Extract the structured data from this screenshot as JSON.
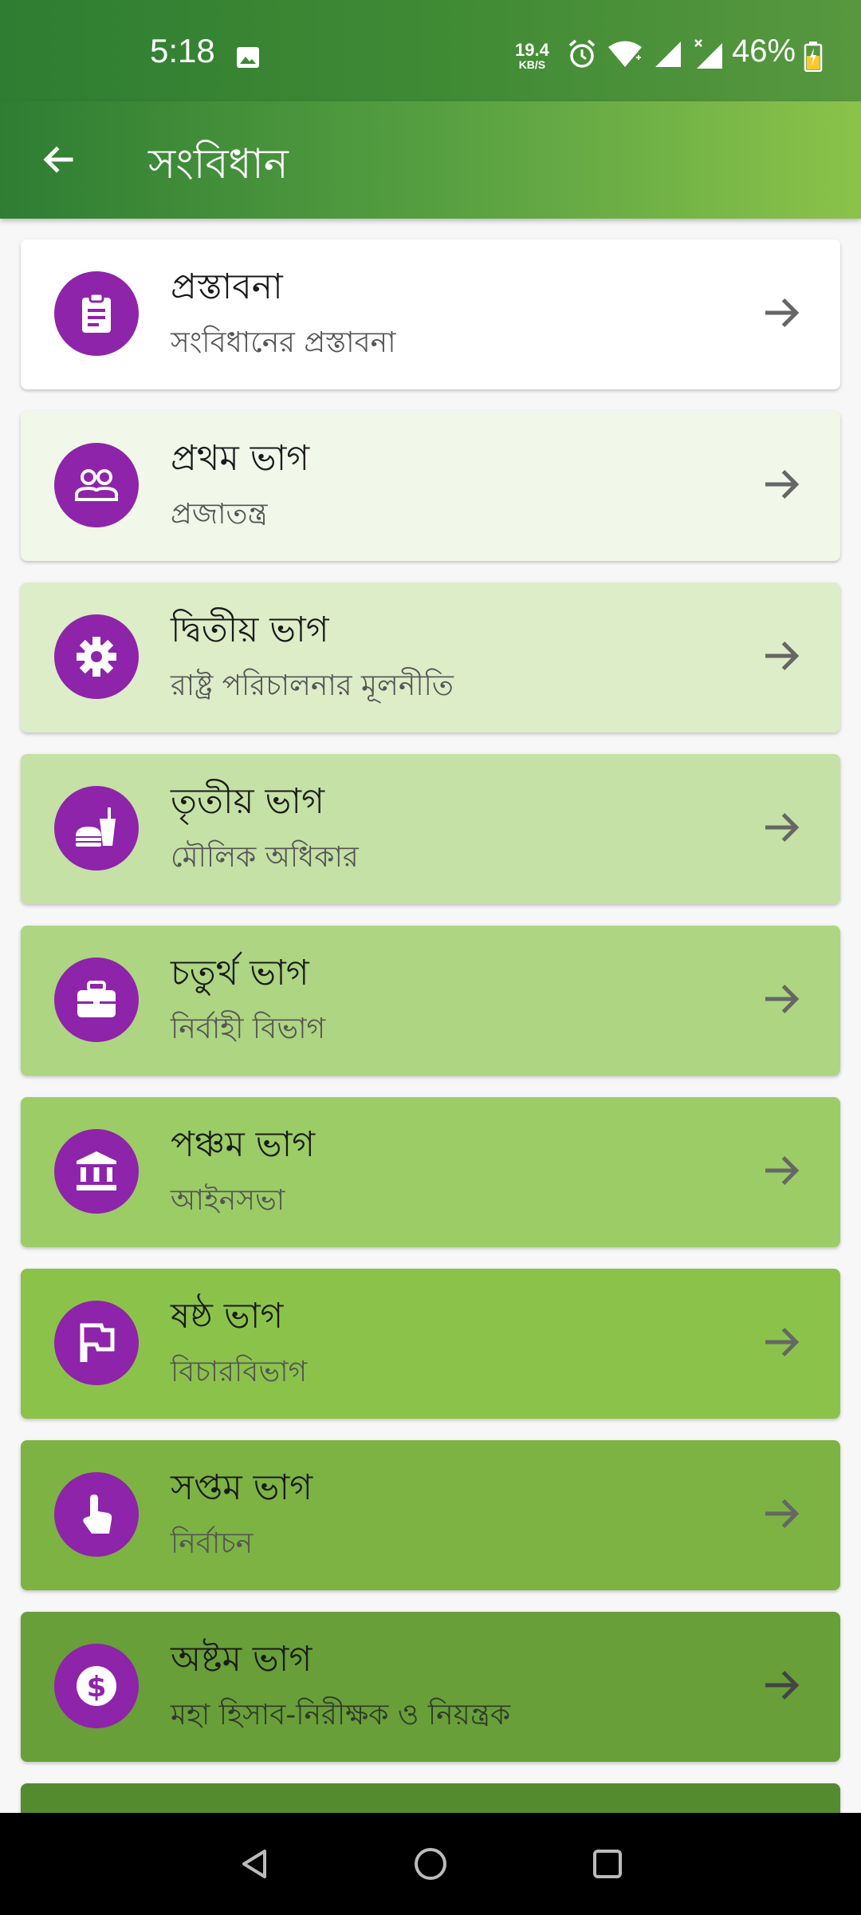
{
  "status_bar": {
    "time": "5:18",
    "net_speed_value": "19.4",
    "net_speed_unit": "KB/S",
    "battery": "46%",
    "icons": [
      "image-icon",
      "alarm-icon",
      "wifi-icon",
      "signal-icon",
      "signal-no-data-icon",
      "battery-charging-icon"
    ]
  },
  "app_bar": {
    "title": "সংবিধান",
    "back_icon": "arrow-back-icon"
  },
  "colors": {
    "icon_circle": "#8e24aa",
    "card_backgrounds": [
      "#ffffff",
      "#f1f8e9",
      "#dcedc8",
      "#c5e1a5",
      "#aed581",
      "#9ccc65",
      "#8bc34a",
      "#7cb342",
      "#689f38",
      "#558b2f"
    ]
  },
  "items": [
    {
      "title": "প্রস্তাবনা",
      "subtitle": "সংবিধানের প্রস্তাবনা",
      "icon": "clipboard-icon"
    },
    {
      "title": "প্রথম ভাগ",
      "subtitle": "প্রজাতন্ত্র",
      "icon": "people-icon"
    },
    {
      "title": "দ্বিতীয় ভাগ",
      "subtitle": "রাষ্ট্র পরিচালনার মূলনীতি",
      "icon": "gear-icon"
    },
    {
      "title": "তৃতীয় ভাগ",
      "subtitle": "মৌলিক অধিকার",
      "icon": "fastfood-icon"
    },
    {
      "title": "চতুর্থ ভাগ",
      "subtitle": "নির্বাহী বিভাগ",
      "icon": "briefcase-icon"
    },
    {
      "title": "পঞ্চম ভাগ",
      "subtitle": "আইনসভা",
      "icon": "bank-icon"
    },
    {
      "title": "ষষ্ঠ ভাগ",
      "subtitle": "বিচারবিভাগ",
      "icon": "flag-icon"
    },
    {
      "title": "সপ্তম ভাগ",
      "subtitle": "নির্বাচন",
      "icon": "touch-icon"
    },
    {
      "title": "অষ্টম ভাগ",
      "subtitle": "মহা হিসাব-নিরীক্ষক ও নিয়ন্ত্রক",
      "icon": "dollar-icon"
    }
  ],
  "nav_bar": {
    "back": "nav-back-icon",
    "home": "nav-home-icon",
    "recents": "nav-recents-icon"
  }
}
